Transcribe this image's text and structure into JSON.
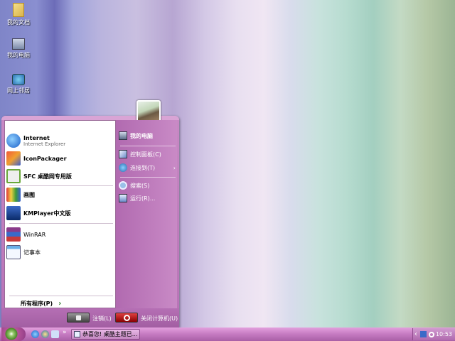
{
  "desktop": {
    "icons": [
      {
        "label": "我的文档",
        "icon": "my-documents-icon"
      },
      {
        "label": "我的电脑",
        "icon": "my-computer-icon"
      },
      {
        "label": "网上邻居",
        "icon": "network-icon"
      }
    ]
  },
  "start_menu": {
    "pinned": [
      {
        "label": "Internet",
        "sub": "Internet Explorer",
        "icon": "ie-icon"
      },
      {
        "label": "IconPackager",
        "icon": "iconpackager-icon"
      },
      {
        "label": "SFC 桌酷网专用版",
        "icon": "sfc-icon"
      }
    ],
    "recent": [
      {
        "label": "画图",
        "icon": "paint-icon"
      },
      {
        "label": "KMPlayer中文版",
        "icon": "kmplayer-icon"
      },
      {
        "label": "WinRAR",
        "icon": "winrar-icon"
      },
      {
        "label": "记事本",
        "icon": "notepad-icon"
      }
    ],
    "all_programs": "所有程序(P)",
    "all_programs_arrow": "›",
    "right": [
      {
        "label": "我的电脑",
        "icon": "computer-icon"
      },
      {
        "label": "控制面板(C)",
        "icon": "control-panel-icon"
      },
      {
        "label": "连接到(T)",
        "icon": "connect-icon",
        "arrow": "›"
      },
      {
        "label": "搜索(S)",
        "icon": "search-icon"
      },
      {
        "label": "运行(R)...",
        "icon": "run-icon"
      }
    ],
    "logoff": "注销(L)",
    "shutdown": "关闭计算机(U)"
  },
  "taskbar": {
    "task_label": "恭喜您! 桌酷主题已...",
    "quicklaunch_more": "»",
    "clock": "10:53",
    "tray_expand": "‹"
  },
  "colors": {
    "accent": "#b872b6",
    "taskbar": "#c57ac1",
    "start_button": "#4a8a2a"
  }
}
